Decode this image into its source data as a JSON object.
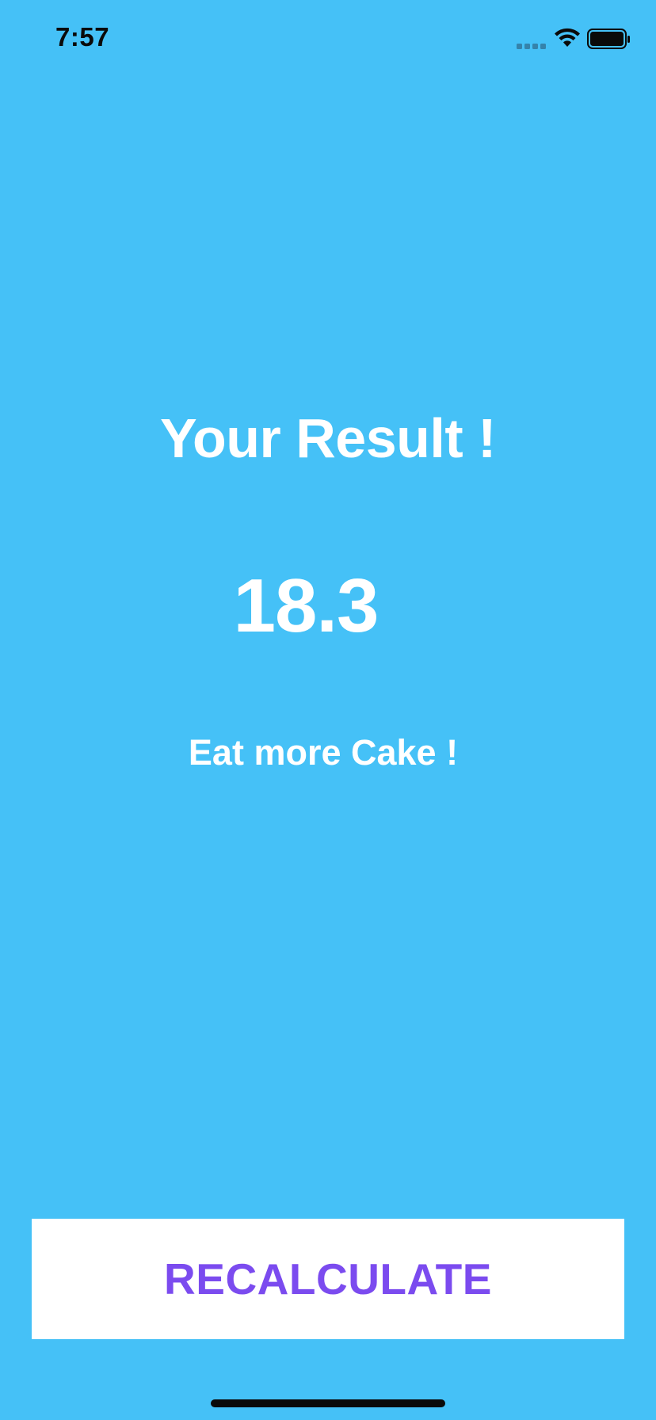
{
  "status_bar": {
    "time": "7:57",
    "icons": [
      "cellular-signal-icon",
      "wifi-icon",
      "battery-icon"
    ]
  },
  "result": {
    "title": "Your Result !",
    "value": "18.3",
    "advice": "Eat more Cake !"
  },
  "actions": {
    "recalculate_label": "RECALCULATE"
  },
  "colors": {
    "background": "#45C1F7",
    "text": "#FFFFFF",
    "button_background": "#FFFFFF",
    "button_text": "#7B4BEF"
  }
}
